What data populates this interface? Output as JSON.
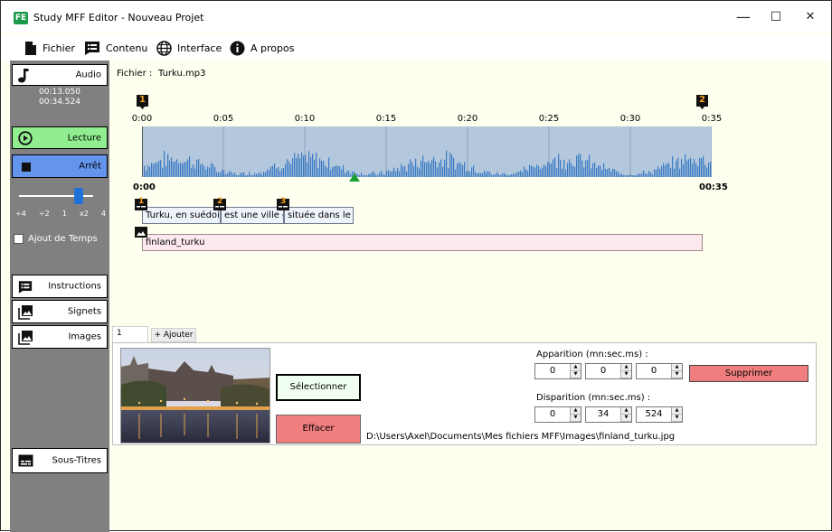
{
  "window": {
    "app_icon": "FE",
    "title": "Study MFF Editor - Nouveau Projet",
    "minimize": "—",
    "maximize": "☐",
    "close": "✕"
  },
  "menu": {
    "file": "Fichier",
    "content": "Contenu",
    "interface": "Interface",
    "about": "A propos"
  },
  "sidebar": {
    "audio_label": "Audio",
    "time_current": "00:13.050",
    "time_total": "00:34.524",
    "play_label": "Lecture",
    "stop_label": "Arrêt",
    "speed_ticks": [
      "÷4",
      "÷2",
      "1",
      "x2",
      "4"
    ],
    "speed_value": "x2",
    "add_time_label": "Ajout de Temps",
    "add_time_checked": false,
    "instructions_label": "Instructions",
    "bookmarks_label": "Signets",
    "images_label": "Images",
    "subtitles_label": "Sous-Titres",
    "colors": {
      "play": "#90ee90",
      "stop": "#6495ed"
    }
  },
  "main": {
    "file_label": "Fichier :",
    "file_name": "Turku.mp3",
    "marker_start": "1",
    "marker_end": "2",
    "ticks": [
      "0:00",
      "0:05",
      "0:10",
      "0:15",
      "0:20",
      "0:25",
      "0:30",
      "0:35"
    ],
    "time_start": "0:00",
    "time_end": "00:35",
    "playhead_seconds": 13.05,
    "duration_seconds": 34.524,
    "subtitles": [
      {
        "index": "1",
        "text": "Turku, en suédois"
      },
      {
        "index": "2",
        "text": "est une ville d"
      },
      {
        "index": "3",
        "text": "située dans le S"
      }
    ],
    "image_track": {
      "label": "finland_turku"
    }
  },
  "image_editor": {
    "tab_number": "1",
    "tab_add": "+ Ajouter",
    "select_button": "Sélectionner",
    "erase_button": "Effacer",
    "file_path": "D:\\Users\\Axel\\Documents\\Mes fichiers MFF\\Images\\finland_turku.jpg",
    "appear_label": "Apparition (mn:sec.ms) :",
    "appear_min": "0",
    "appear_sec": "0",
    "appear_ms": "0",
    "disappear_label": "Disparition (mn:sec.ms) :",
    "disappear_min": "0",
    "disappear_sec": "34",
    "disappear_ms": "524",
    "delete_button": "Supprimer",
    "colors": {
      "delete": "#f07e7e",
      "erase": "#f07e7e",
      "select": "#f0fff0"
    }
  }
}
